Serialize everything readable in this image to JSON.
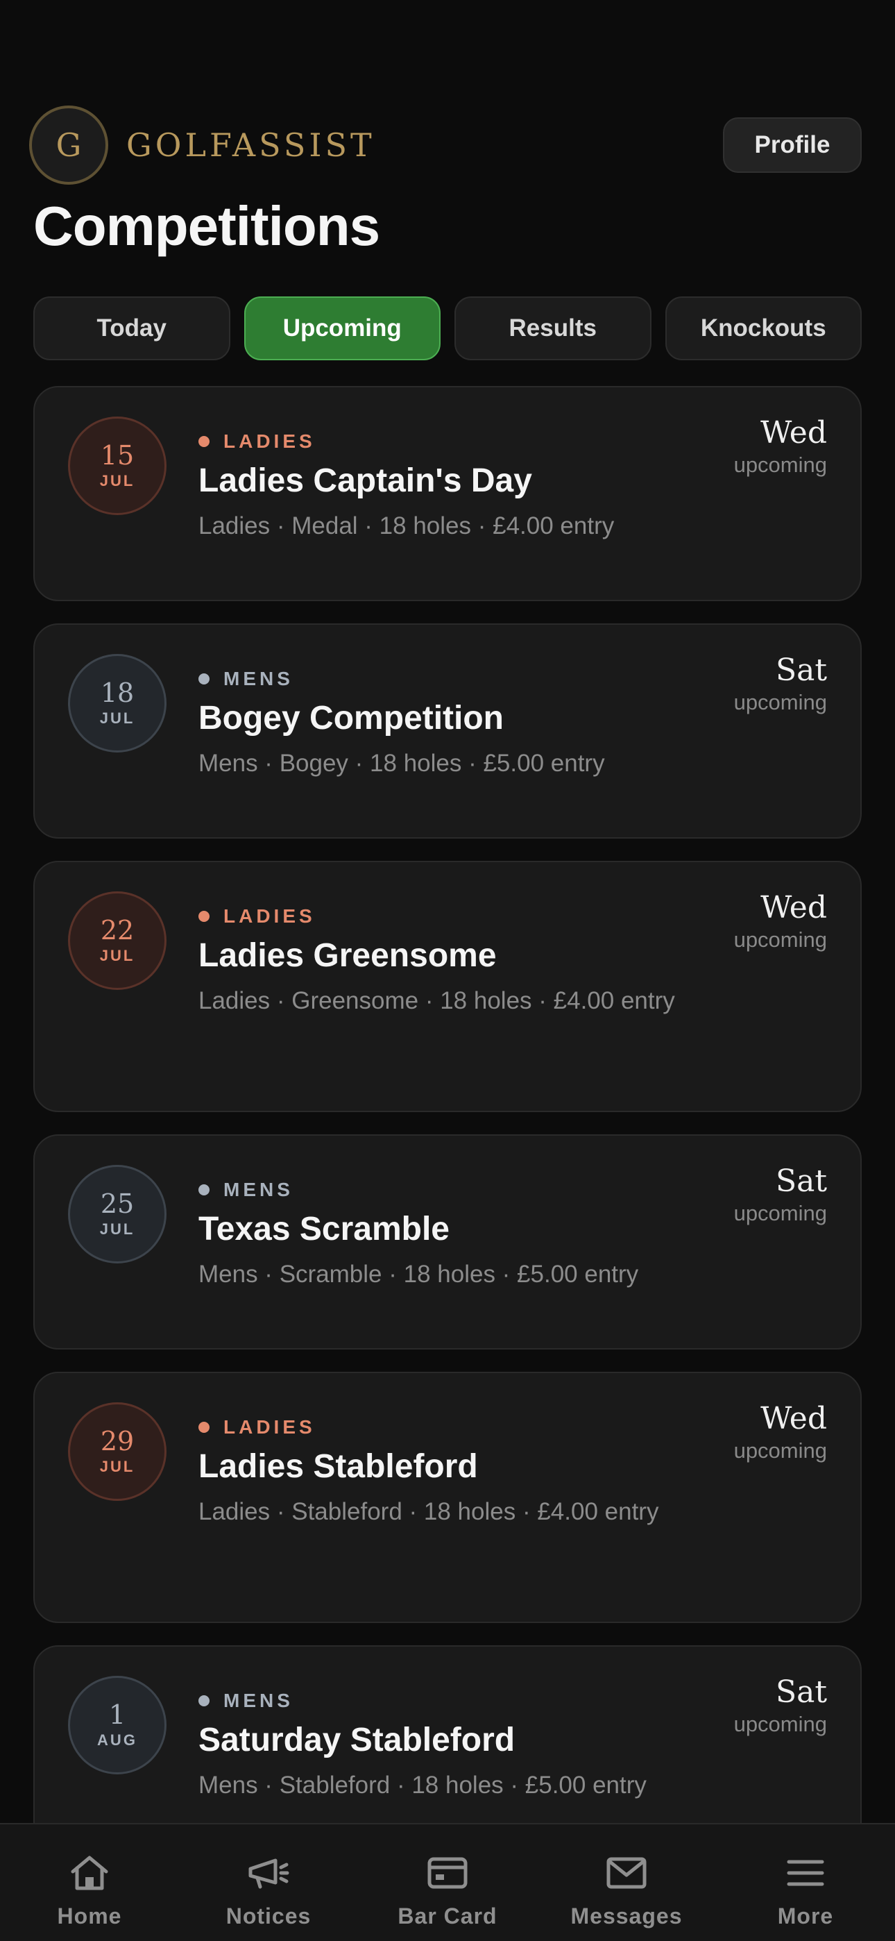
{
  "app": {
    "brand_initial": "G",
    "brand_name": "GOLFASSIST",
    "profile_label": "Profile"
  },
  "page": {
    "title": "Competitions"
  },
  "tabs": [
    {
      "label": "Today",
      "active": false
    },
    {
      "label": "Upcoming",
      "active": true
    },
    {
      "label": "Results",
      "active": false
    },
    {
      "label": "Knockouts",
      "active": false
    }
  ],
  "competitions": [
    {
      "day": "15",
      "month": "JUL",
      "category": "LADIES",
      "name": "Ladies Captain's Day",
      "meta": "Ladies · Medal · 18 holes · £4.00 entry",
      "weekday": "Wed",
      "status": "upcoming"
    },
    {
      "day": "18",
      "month": "JUL",
      "category": "MENS",
      "name": "Bogey Competition",
      "meta": "Mens · Bogey · 18 holes · £5.00 entry",
      "weekday": "Sat",
      "status": "upcoming"
    },
    {
      "day": "22",
      "month": "JUL",
      "category": "LADIES",
      "name": "Ladies Greensome",
      "meta": "Ladies · Greensome · 18 holes · £4.00 entry",
      "weekday": "Wed",
      "status": "upcoming"
    },
    {
      "day": "25",
      "month": "JUL",
      "category": "MENS",
      "name": "Texas Scramble",
      "meta": "Mens · Scramble · 18 holes · £5.00 entry",
      "weekday": "Sat",
      "status": "upcoming"
    },
    {
      "day": "29",
      "month": "JUL",
      "category": "LADIES",
      "name": "Ladies Stableford",
      "meta": "Ladies · Stableford · 18 holes · £4.00 entry",
      "weekday": "Wed",
      "status": "upcoming"
    },
    {
      "day": "1",
      "month": "AUG",
      "category": "MENS",
      "name": "Saturday Stableford",
      "meta": "Mens · Stableford · 18 holes · £5.00 entry",
      "weekday": "Sat",
      "status": "upcoming"
    }
  ],
  "bottom_nav": [
    {
      "label": "Home",
      "icon": "home-icon"
    },
    {
      "label": "Notices",
      "icon": "megaphone-icon"
    },
    {
      "label": "Bar Card",
      "icon": "card-icon"
    },
    {
      "label": "Messages",
      "icon": "mail-icon"
    },
    {
      "label": "More",
      "icon": "menu-icon"
    }
  ],
  "colors": {
    "accent_green": "#2e7d32",
    "gold": "#b8995d",
    "ladies": "#e58a6c",
    "mens": "#a9b2bd"
  }
}
